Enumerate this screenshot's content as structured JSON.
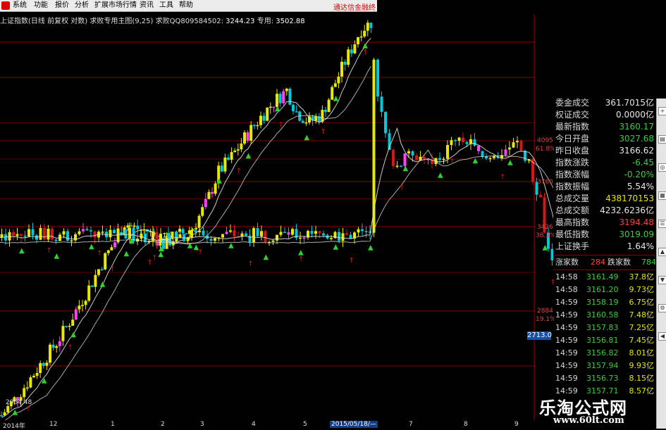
{
  "menubar": {
    "items": [
      "系统",
      "功能",
      "报价",
      "分析",
      "扩展市场行情",
      "资讯",
      "工具",
      "帮助"
    ],
    "promo": "通达信金融终"
  },
  "infobar": {
    "label": "上证指数(日线 前复权 对数) 求败专用主图(9,25) 求败QQ809584502:",
    "value1": "3244.23",
    "label2": "专用:",
    "value2": "3502.88"
  },
  "yaxis_labels": [
    {
      "value": "4095",
      "pct": "61.8%"
    },
    {
      "value": "3760",
      "pct": ""
    },
    {
      "value": "3426",
      "pct": "38.2%"
    },
    {
      "value": "2884",
      "pct": "19.1%"
    }
  ],
  "current_price": "2713.0",
  "low_label": "2064.48",
  "xaxis_labels": [
    "2014年",
    "12",
    "1",
    "2",
    "3",
    "4",
    "5",
    "2015/05/18/—",
    "7",
    "8",
    "9"
  ],
  "panel": {
    "rows": [
      {
        "label": "委金成交",
        "value": "361.7015亿",
        "color": "#e6e6e6"
      },
      {
        "label": "权证成交",
        "value": "0.0000亿",
        "color": "#e6e6e6"
      },
      {
        "label": "最新指数",
        "value": "3160.17",
        "color": "#3dcc3d"
      },
      {
        "label": "今日开盘",
        "value": "3027.68",
        "color": "#3dcc3d"
      },
      {
        "label": "昨日收盘",
        "value": "3166.62",
        "color": "#e6e6e6"
      },
      {
        "label": "指数涨跌",
        "value": "-6.45",
        "color": "#3dcc3d"
      },
      {
        "label": "指数涨幅",
        "value": "-0.20%",
        "color": "#3dcc3d"
      },
      {
        "label": "指数振幅",
        "value": "5.54%",
        "color": "#e6e6e6"
      },
      {
        "label": "总成交量",
        "value": "438170153",
        "color": "#e8e800"
      },
      {
        "label": "总成交额",
        "value": "4232.6236亿",
        "color": "#e6e6e6"
      },
      {
        "label": "最高指数",
        "value": "3194.48",
        "color": "#ff4040"
      },
      {
        "label": "最低指数",
        "value": "3019.09",
        "color": "#3dcc3d"
      },
      {
        "label": "上证换手",
        "value": "1.64%",
        "color": "#e6e6e6"
      }
    ],
    "breadth": {
      "up_label": "涨家数",
      "up": "284",
      "down_label": "跌家数",
      "down": "784"
    },
    "ticks": [
      {
        "time": "14:58",
        "price": "3161.49",
        "vol": "37.8亿"
      },
      {
        "time": "14:58",
        "price": "3161.20",
        "vol": "9.73亿"
      },
      {
        "time": "14:59",
        "price": "3158.19",
        "vol": "6.75亿"
      },
      {
        "time": "14:59",
        "price": "3160.58",
        "vol": "7.48亿"
      },
      {
        "time": "14:59",
        "price": "3157.83",
        "vol": "7.25亿"
      },
      {
        "time": "14:59",
        "price": "3156.81",
        "vol": "7.45亿"
      },
      {
        "time": "14:59",
        "price": "3156.82",
        "vol": "8.01亿"
      },
      {
        "time": "14:59",
        "price": "3157.94",
        "vol": "9.93亿"
      },
      {
        "time": "14:59",
        "price": "3156.73",
        "vol": "8.15亿"
      },
      {
        "time": "14:59",
        "price": "3157.71",
        "vol": "8.57亿"
      }
    ]
  },
  "watermark": {
    "line1": "乐淘公式网",
    "line2": "www.60lt.com"
  },
  "colors": {
    "up": "#e8e800",
    "down": "#00c8d8",
    "magenta": "#ff40ff",
    "red": "#d01818",
    "ma": "#e0e0e0",
    "grid": "#8a0000",
    "signal_up": "#30d030",
    "signal_dn": "#e01010"
  },
  "chart_data": {
    "type": "candlestick",
    "title": "上证指数(日线 前复权 对数)",
    "ylabel": "",
    "ylim": [
      2064.48,
      5178
    ],
    "log_scale": true,
    "fib_levels": [
      {
        "value": 4095,
        "label": "61.8%"
      },
      {
        "value": 3760,
        "label": ""
      },
      {
        "value": 3426,
        "label": "38.2%"
      },
      {
        "value": 2884,
        "label": "19.1%"
      }
    ],
    "segments": [
      {
        "name": "rally",
        "points": [
          [
            0,
            2064
          ],
          [
            10,
            2160
          ],
          [
            22,
            2300
          ],
          [
            35,
            2460
          ],
          [
            45,
            2620
          ],
          [
            55,
            2800
          ],
          [
            62,
            2950
          ],
          [
            70,
            3100
          ],
          [
            76,
            3240
          ],
          [
            82,
            3200
          ],
          [
            90,
            3180
          ],
          [
            100,
            3080
          ],
          [
            110,
            3150
          ],
          [
            118,
            3200
          ],
          [
            126,
            3380
          ],
          [
            134,
            3650
          ],
          [
            142,
            3780
          ],
          [
            150,
            3950
          ],
          [
            160,
            4150
          ],
          [
            168,
            4300
          ],
          [
            176,
            4420
          ],
          [
            182,
            4200
          ],
          [
            190,
            4100
          ],
          [
            198,
            4180
          ],
          [
            206,
            4500
          ],
          [
            214,
            4800
          ],
          [
            222,
            5100
          ],
          [
            228,
            5178
          ]
        ]
      },
      {
        "name": "crash",
        "points": [
          [
            262,
            4700
          ],
          [
            266,
            4150
          ],
          [
            270,
            3800
          ],
          [
            274,
            3700
          ],
          [
            280,
            3850
          ],
          [
            286,
            3790
          ],
          [
            292,
            3700
          ],
          [
            300,
            3850
          ],
          [
            306,
            3950
          ],
          [
            312,
            3880
          ],
          [
            318,
            3750
          ],
          [
            324,
            3780
          ],
          [
            330,
            3850
          ],
          [
            336,
            3900
          ],
          [
            342,
            3700
          ],
          [
            348,
            3400
          ],
          [
            352,
            3000
          ],
          [
            356,
            2850
          ],
          [
            360,
            3050
          ],
          [
            364,
            3150
          ]
        ]
      }
    ]
  }
}
